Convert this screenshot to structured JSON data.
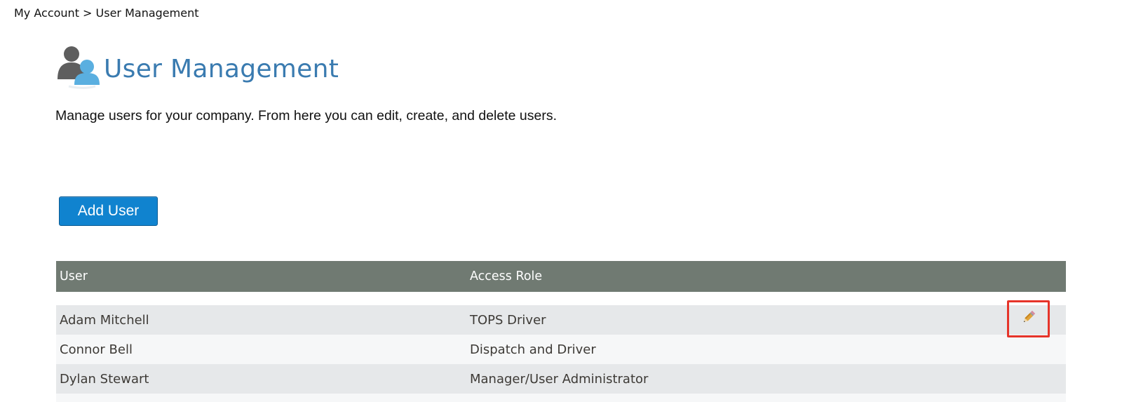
{
  "breadcrumb": "My Account > User Management",
  "header": {
    "title": "User Management",
    "icon": "users-icon"
  },
  "description": "Manage users for your company. From here you can edit, create, and delete users.",
  "add_button": {
    "label": "Add User",
    "color": "#1083cf"
  },
  "table": {
    "header_color": "#707a72",
    "columns": [
      "User",
      "Access Role"
    ],
    "rows": [
      {
        "user": "Adam Mitchell",
        "role": "TOPS Driver",
        "action_icon": "pencil-icon"
      },
      {
        "user": "Connor Bell",
        "role": "Dispatch and Driver"
      },
      {
        "user": "Dylan Stewart",
        "role": "Manager/User Administrator"
      }
    ]
  },
  "highlight_color": "#e6342a"
}
